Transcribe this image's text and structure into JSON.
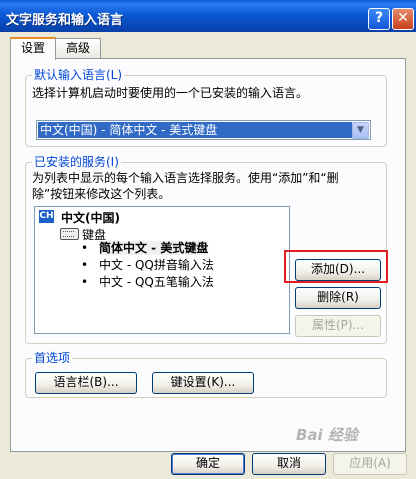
{
  "window": {
    "title": "文字服务和输入语言",
    "help_glyph": "?",
    "close_glyph": "✕"
  },
  "tabs": [
    {
      "label": "设置",
      "active": true
    },
    {
      "label": "高级",
      "active": false
    }
  ],
  "default_lang": {
    "group_title": "默认输入语言(L)",
    "description": "选择计算机启动时要使用的一个已安装的输入语言。",
    "selected": "中文(中国) - 简体中文 - 美式键盘",
    "arrow_glyph": "▼"
  },
  "installed_services": {
    "group_title": "已安装的服务(I)",
    "description_line1": "为列表中显示的每个输入语言选择服务。使用“添加”和“删",
    "description_line2": "除”按钮来修改这个列表。",
    "language_badge": "CH",
    "language_name": "中文(中国)",
    "category": "键盘",
    "bullet": "•",
    "items": [
      {
        "name": "简体中文 - 美式键盘",
        "selected": true
      },
      {
        "name": "中文 - QQ拼音输入法",
        "selected": false
      },
      {
        "name": "中文 - QQ五笔输入法",
        "selected": false
      }
    ],
    "buttons": {
      "add": "添加(D)...",
      "remove": "删除(R)",
      "properties": "属性(P)..."
    }
  },
  "preferences": {
    "group_title": "首选项",
    "language_bar": "语言栏(B)...",
    "key_settings": "键设置(K)..."
  },
  "footer": {
    "ok": "确定",
    "cancel": "取消",
    "apply": "应用(A)"
  },
  "watermark": "Bai 经验",
  "colors": {
    "title_bar": "#0a5bd8",
    "group_title": "#0046d5",
    "selection": "#316ac5",
    "highlight_box": "#e02020"
  }
}
